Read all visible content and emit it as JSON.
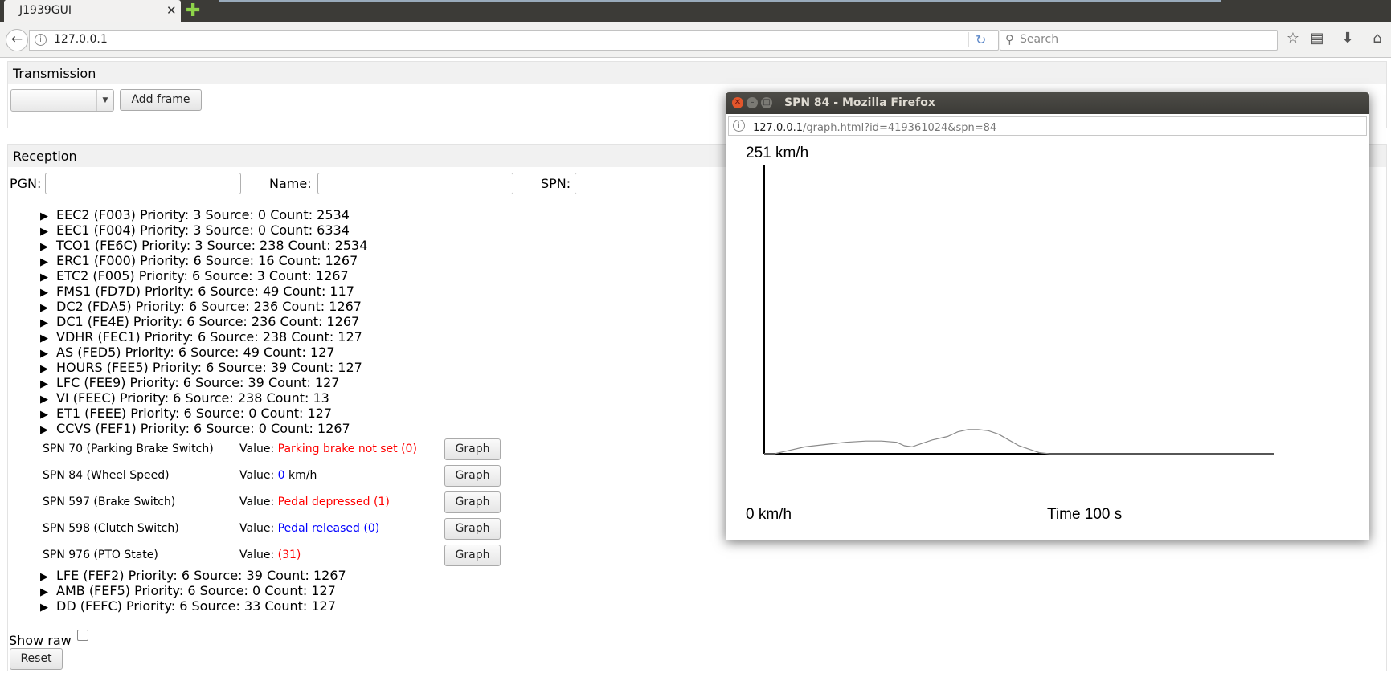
{
  "browser": {
    "tab_title": "J1939GUI",
    "url": "127.0.0.1",
    "search_placeholder": "Search"
  },
  "transmission": {
    "legend": "Transmission",
    "add_frame_label": "Add frame"
  },
  "reception": {
    "legend": "Reception",
    "filter_pgn_label": "PGN:",
    "filter_name_label": "Name:",
    "filter_spn_label": "SPN:",
    "pgns_top": [
      "EEC2 (F003) Priority: 3 Source: 0 Count: 2534",
      "EEC1 (F004) Priority: 3 Source: 0 Count: 6334",
      "TCO1 (FE6C) Priority: 3 Source: 238 Count: 2534",
      "ERC1 (F000) Priority: 6 Source: 16 Count: 1267",
      "ETC2 (F005) Priority: 6 Source: 3 Count: 1267",
      "FMS1 (FD7D) Priority: 6 Source: 49 Count: 117",
      "DC2 (FDA5) Priority: 6 Source: 236 Count: 1267",
      "DC1 (FE4E) Priority: 6 Source: 236 Count: 1267",
      "VDHR (FEC1) Priority: 6 Source: 238 Count: 127",
      "AS (FED5) Priority: 6 Source: 49 Count: 127",
      "HOURS (FEE5) Priority: 6 Source: 39 Count: 127",
      "LFC (FEE9) Priority: 6 Source: 39 Count: 127",
      "VI (FEEC) Priority: 6 Source: 238 Count: 13",
      "ET1 (FEEE) Priority: 6 Source: 0 Count: 127",
      "CCVS (FEF1) Priority: 6 Source: 0 Count: 1267"
    ],
    "spns": [
      {
        "label": "SPN 70 (Parking Brake Switch)",
        "value_prefix": "Value: ",
        "value": "Parking brake not set (0)",
        "value_color": "#ff0000",
        "unit": "",
        "button": "Graph"
      },
      {
        "label": "SPN 84 (Wheel Speed)",
        "value_prefix": "Value: ",
        "value": "0",
        "value_color": "#0000ff",
        "unit": " km/h",
        "button": "Graph"
      },
      {
        "label": "SPN 597 (Brake Switch)",
        "value_prefix": "Value: ",
        "value": "Pedal depressed (1)",
        "value_color": "#ff0000",
        "unit": "",
        "button": "Graph"
      },
      {
        "label": "SPN 598 (Clutch Switch)",
        "value_prefix": "Value: ",
        "value": "Pedal released (0)",
        "value_color": "#0000ff",
        "unit": "",
        "button": "Graph"
      },
      {
        "label": "SPN 976 (PTO State)",
        "value_prefix": "Value: ",
        "value": "(31)",
        "value_color": "#ff0000",
        "unit": "",
        "button": "Graph"
      }
    ],
    "pgns_bottom": [
      "LFE (FEF2) Priority: 6 Source: 39 Count: 1267",
      "AMB (FEF5) Priority: 6 Source: 0 Count: 127",
      "DD (FEFC) Priority: 6 Source: 33 Count: 127"
    ],
    "show_raw_label": "Show raw",
    "reset_label": "Reset"
  },
  "popup": {
    "title": "SPN 84 - Mozilla Firefox",
    "url_host": "127.0.0.1",
    "url_path": "/graph.html?id=419361024&spn=84",
    "max_label": "251 km/h",
    "min_label": "0 km/h",
    "time_label": "Time 100 s"
  },
  "chart_data": {
    "type": "line",
    "ylim": [
      0,
      251
    ],
    "xlim": [
      0,
      100
    ],
    "series": [
      {
        "x": [
          0,
          2,
          5,
          8,
          12,
          16,
          20,
          23,
          26,
          27.5,
          29,
          31,
          33,
          36,
          38,
          40,
          42,
          44,
          46,
          48,
          50,
          52,
          54,
          56,
          58,
          60,
          100
        ],
        "values": [
          0,
          0,
          3,
          6,
          8,
          10,
          11,
          11,
          10,
          7,
          6,
          9,
          12,
          15,
          19,
          21,
          21,
          20,
          17,
          12,
          7,
          4,
          1,
          0,
          0,
          0,
          0
        ]
      }
    ]
  }
}
